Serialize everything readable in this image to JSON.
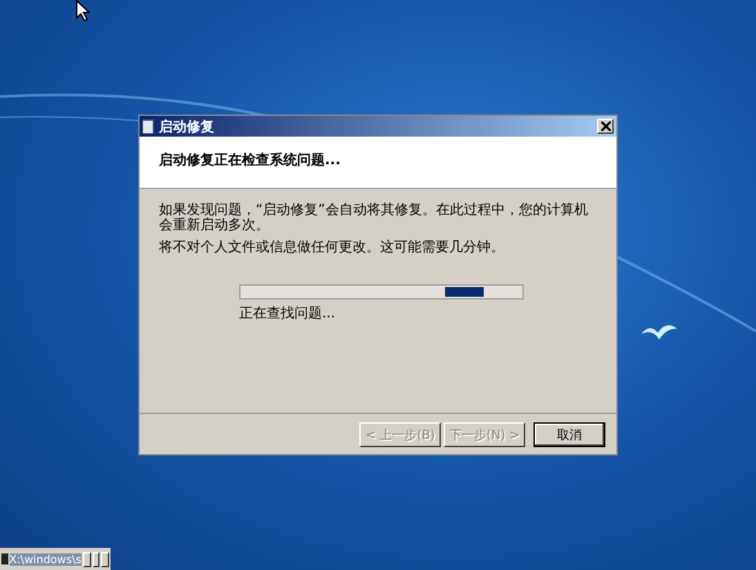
{
  "dialog": {
    "title": "启动修复",
    "heading": "启动修复正在检查系统问题...",
    "paragraphs": [
      "如果发现问题，“启动修复”会自动将其修复。在此过程中，您的计算机会重新启动多次。",
      "将不对个人文件或信息做任何更改。这可能需要几分钟。"
    ],
    "progress": {
      "marquee": true,
      "status": "正在查找问题..."
    },
    "buttons": [
      {
        "label": "< 上一步(B)",
        "disabled": true
      },
      {
        "label": "下一步(N) >",
        "disabled": true
      },
      {
        "label": "取消",
        "disabled": false
      }
    ]
  },
  "console_window": {
    "title": "X:\\windows\\s"
  }
}
